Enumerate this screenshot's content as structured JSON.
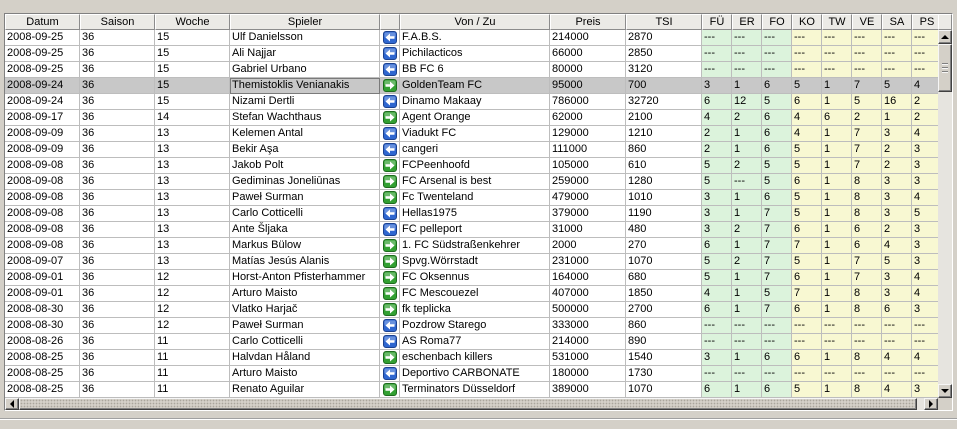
{
  "colors": {
    "window_bg": "#d4d0c8",
    "header_bg": "#ebeae6",
    "grid": "#bdbdbd",
    "cell_bg": "#ffffff",
    "selected_bg": "#c8c8c8",
    "text": "#000000",
    "icon_in": "#2f67d0",
    "icon_out": "#32a032"
  },
  "table": {
    "headers": {
      "datum": "Datum",
      "saison": "Saison",
      "woche": "Woche",
      "spieler": "Spieler",
      "von_zu": "Von / Zu",
      "preis": "Preis",
      "tsi": "TSI"
    },
    "skill_columns": [
      {
        "label": "FÜ",
        "bg": "#dcf3dc"
      },
      {
        "label": "ER",
        "bg": "#dcf3dc"
      },
      {
        "label": "FO",
        "bg": "#dcf3dc"
      },
      {
        "label": "KO",
        "bg": "#f8f8d2"
      },
      {
        "label": "TW",
        "bg": "#f8f8d2"
      },
      {
        "label": "VE",
        "bg": "#f8f8d2"
      },
      {
        "label": "SA",
        "bg": "#f8f8d2"
      },
      {
        "label": "PS",
        "bg": "#f8f8d2"
      }
    ],
    "rows": [
      {
        "datum": "2008-09-25",
        "saison": "36",
        "woche": "15",
        "spieler": "Ulf Danielsson",
        "icon": "arrow-left-icon",
        "von_zu": "F.A.B.S.",
        "preis": "214000",
        "tsi": "2870",
        "skills": [
          "---",
          "---",
          "---",
          "---",
          "---",
          "---",
          "---",
          "---"
        ]
      },
      {
        "datum": "2008-09-25",
        "saison": "36",
        "woche": "15",
        "spieler": "Ali Najjar",
        "icon": "arrow-left-icon",
        "von_zu": "Pichilacticos",
        "preis": "66000",
        "tsi": "2850",
        "skills": [
          "---",
          "---",
          "---",
          "---",
          "---",
          "---",
          "---",
          "---"
        ]
      },
      {
        "datum": "2008-09-25",
        "saison": "36",
        "woche": "15",
        "spieler": "Gabriel Urbano",
        "icon": "arrow-left-icon",
        "von_zu": "BB FC 6",
        "preis": "80000",
        "tsi": "3120",
        "skills": [
          "---",
          "---",
          "---",
          "---",
          "---",
          "---",
          "---",
          "---"
        ]
      },
      {
        "datum": "2008-09-24",
        "saison": "36",
        "woche": "15",
        "spieler": "Themistoklis Venianakis",
        "icon": "arrow-right-icon",
        "von_zu": "GoldenTeam FC",
        "preis": "95000",
        "tsi": "700",
        "skills": [
          "3",
          "1",
          "6",
          "5",
          "1",
          "7",
          "5",
          "4"
        ],
        "selected": true
      },
      {
        "datum": "2008-09-24",
        "saison": "36",
        "woche": "15",
        "spieler": "Nizami Dertli",
        "icon": "arrow-left-icon",
        "von_zu": "Dinamo Makaay",
        "preis": "786000",
        "tsi": "32720",
        "skills": [
          "6",
          "12",
          "5",
          "6",
          "1",
          "5",
          "16",
          "2"
        ]
      },
      {
        "datum": "2008-09-17",
        "saison": "36",
        "woche": "14",
        "spieler": "Stefan Wachthaus",
        "icon": "arrow-right-icon",
        "von_zu": "Agent Orange",
        "preis": "62000",
        "tsi": "2100",
        "skills": [
          "4",
          "2",
          "6",
          "4",
          "6",
          "2",
          "1",
          "2"
        ]
      },
      {
        "datum": "2008-09-09",
        "saison": "36",
        "woche": "13",
        "spieler": "Kelemen Antal",
        "icon": "arrow-left-icon",
        "von_zu": "Viadukt FC",
        "preis": "129000",
        "tsi": "1210",
        "skills": [
          "2",
          "1",
          "6",
          "4",
          "1",
          "7",
          "3",
          "4"
        ]
      },
      {
        "datum": "2008-09-09",
        "saison": "36",
        "woche": "13",
        "spieler": "Bekir Aşa",
        "icon": "arrow-left-icon",
        "von_zu": "cangeri",
        "preis": "111000",
        "tsi": "860",
        "skills": [
          "2",
          "1",
          "6",
          "5",
          "1",
          "7",
          "2",
          "3"
        ]
      },
      {
        "datum": "2008-09-08",
        "saison": "36",
        "woche": "13",
        "spieler": "Jakob Polt",
        "icon": "arrow-right-icon",
        "von_zu": "FCPeenhoofd",
        "preis": "105000",
        "tsi": "610",
        "skills": [
          "5",
          "2",
          "5",
          "5",
          "1",
          "7",
          "2",
          "3"
        ]
      },
      {
        "datum": "2008-09-08",
        "saison": "36",
        "woche": "13",
        "spieler": "Gediminas Joneliūnas",
        "icon": "arrow-right-icon",
        "von_zu": "FC Arsenal is best",
        "preis": "259000",
        "tsi": "1280",
        "skills": [
          "5",
          "---",
          "5",
          "6",
          "1",
          "8",
          "3",
          "3"
        ]
      },
      {
        "datum": "2008-09-08",
        "saison": "36",
        "woche": "13",
        "spieler": "Paweł Surman",
        "icon": "arrow-right-icon",
        "von_zu": "Fc Twenteland",
        "preis": "479000",
        "tsi": "1010",
        "skills": [
          "3",
          "1",
          "6",
          "5",
          "1",
          "8",
          "3",
          "4"
        ]
      },
      {
        "datum": "2008-09-08",
        "saison": "36",
        "woche": "13",
        "spieler": "Carlo Cotticelli",
        "icon": "arrow-left-icon",
        "von_zu": "Hellas1975",
        "preis": "379000",
        "tsi": "1190",
        "skills": [
          "3",
          "1",
          "7",
          "5",
          "1",
          "8",
          "3",
          "5"
        ]
      },
      {
        "datum": "2008-09-08",
        "saison": "36",
        "woche": "13",
        "spieler": "Ante Šljaka",
        "icon": "arrow-left-icon",
        "von_zu": "FC pelleport",
        "preis": "31000",
        "tsi": "480",
        "skills": [
          "3",
          "2",
          "7",
          "6",
          "1",
          "6",
          "2",
          "3"
        ]
      },
      {
        "datum": "2008-09-08",
        "saison": "36",
        "woche": "13",
        "spieler": "Markus Bülow",
        "icon": "arrow-right-icon",
        "von_zu": "1. FC Südstraßenkehrer",
        "preis": "2000",
        "tsi": "270",
        "skills": [
          "6",
          "1",
          "7",
          "7",
          "1",
          "6",
          "4",
          "3"
        ]
      },
      {
        "datum": "2008-09-07",
        "saison": "36",
        "woche": "13",
        "spieler": "Matías Jesús Alanis",
        "icon": "arrow-right-icon",
        "von_zu": "Spvg.Wörrstadt",
        "preis": "231000",
        "tsi": "1070",
        "skills": [
          "5",
          "2",
          "7",
          "5",
          "1",
          "7",
          "5",
          "3"
        ]
      },
      {
        "datum": "2008-09-01",
        "saison": "36",
        "woche": "12",
        "spieler": "Horst-Anton Pfisterhammer",
        "icon": "arrow-right-icon",
        "von_zu": "FC Oksennus",
        "preis": "164000",
        "tsi": "680",
        "skills": [
          "5",
          "1",
          "7",
          "6",
          "1",
          "7",
          "3",
          "4"
        ]
      },
      {
        "datum": "2008-09-01",
        "saison": "36",
        "woche": "12",
        "spieler": "Arturo Maisto",
        "icon": "arrow-right-icon",
        "von_zu": "FC Mescouezel",
        "preis": "407000",
        "tsi": "1850",
        "skills": [
          "4",
          "1",
          "5",
          "7",
          "1",
          "8",
          "3",
          "4"
        ]
      },
      {
        "datum": "2008-08-30",
        "saison": "36",
        "woche": "12",
        "spieler": "Vlatko Harjač",
        "icon": "arrow-right-icon",
        "von_zu": "fk teplicka",
        "preis": "500000",
        "tsi": "2700",
        "skills": [
          "6",
          "1",
          "7",
          "6",
          "1",
          "8",
          "6",
          "3"
        ]
      },
      {
        "datum": "2008-08-30",
        "saison": "36",
        "woche": "12",
        "spieler": "Paweł Surman",
        "icon": "arrow-left-icon",
        "von_zu": "Pozdrow Starego",
        "preis": "333000",
        "tsi": "860",
        "skills": [
          "---",
          "---",
          "---",
          "---",
          "---",
          "---",
          "---",
          "---"
        ]
      },
      {
        "datum": "2008-08-26",
        "saison": "36",
        "woche": "11",
        "spieler": "Carlo Cotticelli",
        "icon": "arrow-left-icon",
        "von_zu": "AS Roma77",
        "preis": "214000",
        "tsi": "890",
        "skills": [
          "---",
          "---",
          "---",
          "---",
          "---",
          "---",
          "---",
          "---"
        ]
      },
      {
        "datum": "2008-08-25",
        "saison": "36",
        "woche": "11",
        "spieler": "Halvdan Håland",
        "icon": "arrow-right-icon",
        "von_zu": "eschenbach killers",
        "preis": "531000",
        "tsi": "1540",
        "skills": [
          "3",
          "1",
          "6",
          "6",
          "1",
          "8",
          "4",
          "4"
        ]
      },
      {
        "datum": "2008-08-25",
        "saison": "36",
        "woche": "11",
        "spieler": "Arturo Maisto",
        "icon": "arrow-left-icon",
        "von_zu": "Deportivo CARBONATE",
        "preis": "180000",
        "tsi": "1730",
        "skills": [
          "---",
          "---",
          "---",
          "---",
          "---",
          "---",
          "---",
          "---"
        ]
      },
      {
        "datum": "2008-08-25",
        "saison": "36",
        "woche": "11",
        "spieler": "Renato Aguilar",
        "icon": "arrow-right-icon",
        "von_zu": "Terminators Düsseldorf",
        "preis": "389000",
        "tsi": "1070",
        "skills": [
          "6",
          "1",
          "6",
          "5",
          "1",
          "8",
          "4",
          "3"
        ]
      }
    ]
  }
}
